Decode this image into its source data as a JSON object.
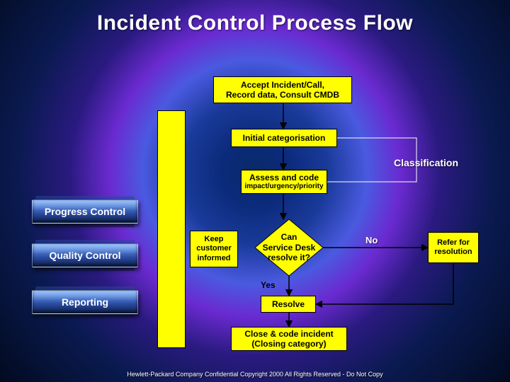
{
  "title": "Incident Control Process Flow",
  "flow": {
    "accept": "Accept Incident/Call,\nRecord data, Consult CMDB",
    "initial_cat": "Initial categorisation",
    "assess": "Assess and code",
    "assess_sub": "impact/urgency/priority",
    "keep_informed": "Keep\ncustomer\ninformed",
    "decision": "Can\nService Desk\nresolve it?",
    "refer": "Refer for\nresolution",
    "resolve": "Resolve",
    "close": "Close & code incident\n(Closing category)"
  },
  "labels": {
    "classification": "Classification",
    "no": "No",
    "yes": "Yes"
  },
  "side": {
    "progress": "Progress Control",
    "quality": "Quality Control",
    "reporting": "Reporting"
  },
  "footer": "Hewlett-Packard Company Confidential Copyright 2000 All Rights Reserved - Do Not Copy",
  "colors": {
    "node_fill": "#ffff00"
  }
}
